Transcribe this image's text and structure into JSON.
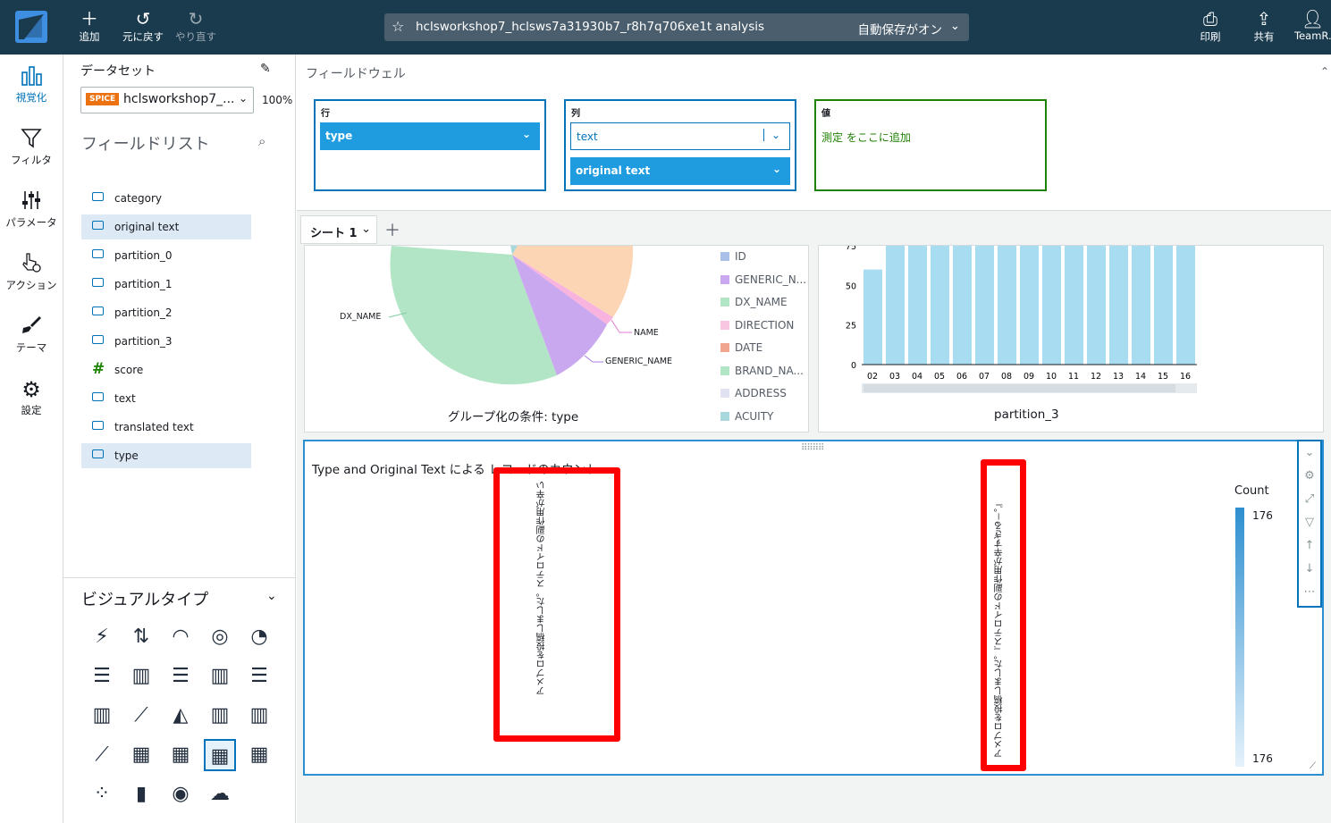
{
  "topbar": {
    "add_label": "追加",
    "undo_label": "元に戻す",
    "redo_label": "やり直す",
    "title": "hclsworkshop7_hclsws7a31930b7_r8h7q706xe1t analysis",
    "autosave": "自動保存がオン",
    "print_label": "印刷",
    "share_label": "共有",
    "user_label": "TeamR..."
  },
  "leftnav": [
    {
      "label": "視覚化",
      "icon": "bar-chart-icon"
    },
    {
      "label": "フィルタ",
      "icon": "filter-icon"
    },
    {
      "label": "パラメータ",
      "icon": "sliders-icon"
    },
    {
      "label": "アクション",
      "icon": "pointer-gear-icon"
    },
    {
      "label": "テーマ",
      "icon": "brush-icon"
    },
    {
      "label": "設定",
      "icon": "gear-icon"
    }
  ],
  "dataset": {
    "label": "データセット",
    "badge": "SPICE",
    "name": "hclsworkshop7_...",
    "percent": "100%"
  },
  "fieldlist": {
    "title": "フィールドリスト",
    "fields": [
      {
        "name": "category",
        "type": "dimension",
        "selected": false
      },
      {
        "name": "original text",
        "type": "dimension",
        "selected": true
      },
      {
        "name": "partition_0",
        "type": "dimension",
        "selected": false
      },
      {
        "name": "partition_1",
        "type": "dimension",
        "selected": false
      },
      {
        "name": "partition_2",
        "type": "dimension",
        "selected": false
      },
      {
        "name": "partition_3",
        "type": "dimension",
        "selected": false
      },
      {
        "name": "score",
        "type": "measure",
        "selected": false
      },
      {
        "name": "text",
        "type": "dimension",
        "selected": false
      },
      {
        "name": "translated text",
        "type": "dimension",
        "selected": false
      },
      {
        "name": "type",
        "type": "dimension",
        "selected": true
      }
    ]
  },
  "visualtypes": {
    "title": "ビジュアルタイプ",
    "icons": [
      "kpi-icon",
      "autograph-icon",
      "gauge-icon",
      "donut-icon",
      "pie-icon",
      "hbar-icon",
      "vbar-icon",
      "hbar-grouped-icon",
      "vbar-grouped-icon",
      "hbar-stacked-icon",
      "vbar-stacked-icon",
      "line-icon",
      "area-icon",
      "combo-bar-line-icon",
      "combo-stacked-line-icon",
      "line-area-icon",
      "table-icon",
      "pivot-table-icon",
      "heatmap-icon",
      "treemap-icon",
      "scatter-icon",
      "histogram-icon",
      "map-icon",
      "wordcloud-icon"
    ],
    "selected_index": 18
  },
  "fieldwell": {
    "title": "フィールドウェル",
    "rows_label": "行",
    "rows_value": "type",
    "cols_label": "列",
    "cols_values": [
      "text",
      "original text"
    ],
    "values_label": "値",
    "values_placeholder": "測定 をここに追加"
  },
  "sheet": {
    "tab_label": "シート 1"
  },
  "pie_visual": {
    "caption": "グループ化の条件: type",
    "slice_labels": [
      "DX_NAME",
      "NAME",
      "GENERIC_NAME"
    ],
    "legend": [
      {
        "label": "ID",
        "color": "#a9bfe8"
      },
      {
        "label": "GENERIC_N...",
        "color": "#c9a8f0"
      },
      {
        "label": "DX_NAME",
        "color": "#b2e5c6"
      },
      {
        "label": "DIRECTION",
        "color": "#f8c6e0"
      },
      {
        "label": "DATE",
        "color": "#f0a590"
      },
      {
        "label": "BRAND_NA...",
        "color": "#b2e5c6"
      },
      {
        "label": "ADDRESS",
        "color": "#e0e2f2"
      },
      {
        "label": "ACUITY",
        "color": "#a8d8dc"
      }
    ]
  },
  "bar_visual": {
    "caption": "partition_3",
    "categories": [
      "02",
      "03",
      "04",
      "05",
      "06",
      "07",
      "08",
      "09",
      "10",
      "11",
      "12",
      "13",
      "14",
      "15",
      "16"
    ],
    "y_ticks": [
      "75",
      "50",
      "25",
      "0"
    ]
  },
  "chart_data": {
    "type": "bar",
    "categories": [
      "02",
      "03",
      "04",
      "05",
      "06",
      "07",
      "08",
      "09",
      "10",
      "11",
      "12",
      "13",
      "14",
      "15",
      "16"
    ],
    "values": [
      60,
      75,
      75,
      75,
      75,
      75,
      75,
      75,
      75,
      75,
      75,
      75,
      75,
      75,
      75
    ],
    "ylim": [
      0,
      75
    ],
    "xlabel": "partition_3",
    "ylabel": ""
  },
  "heatmap_visual": {
    "title": "Type and Original Text による レコードのカウント",
    "col1_text": "アメプロを投稿しました。ステロイドの副作用が辛い",
    "col2_text": "アメプロを投稿しました。『ステロイドの副作用が辛すぎる－。』",
    "legend_title": "Count",
    "legend_max": "176",
    "legend_min": "176",
    "accent": "#2e8fd0"
  }
}
